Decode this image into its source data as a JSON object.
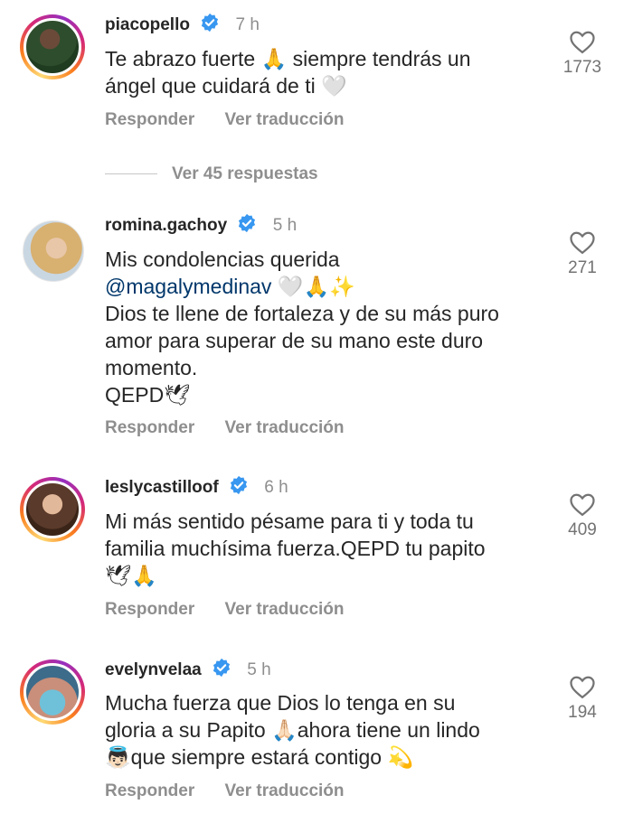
{
  "comments": [
    {
      "username": "piacopello",
      "time": "7 h",
      "text_lines": [
        "Te abrazo fuerte 🙏 siempre tendrás un",
        "ángel que cuidará de ti 🤍"
      ],
      "likes": "1773",
      "reply_label": "Responder",
      "translate_label": "Ver traducción",
      "view_replies": "Ver 45 respuestas",
      "avatar_icon": "profile-photo"
    },
    {
      "username": "romina.gachoy",
      "time": "5 h",
      "line1": "Mis condolencias querida",
      "mention": "@magalymedinav",
      "mention_suffix": " 🤍🙏✨",
      "line3": "Dios te llene de fortaleza y de su más puro",
      "line4": "amor para superar de su mano este duro",
      "line5": "momento.",
      "line6": "QEPD🕊",
      "likes": "271",
      "reply_label": "Responder",
      "translate_label": "Ver traducción",
      "avatar_icon": "profile-photo"
    },
    {
      "username": "leslycastilloof",
      "time": "6 h",
      "text_lines": [
        "Mi más sentido pésame para ti y toda tu",
        "familia muchísima fuerza.QEPD tu papito",
        "🕊🙏"
      ],
      "likes": "409",
      "reply_label": "Responder",
      "translate_label": "Ver traducción",
      "avatar_icon": "profile-photo"
    },
    {
      "username": "evelynvelaa",
      "time": "5 h",
      "text_lines": [
        "Mucha fuerza que Dios lo tenga en su",
        "gloria a su Papito 🙏🏻ahora tiene un lindo",
        "👼🏻que siempre estará contigo 💫"
      ],
      "likes": "194",
      "reply_label": "Responder",
      "translate_label": "Ver traducción",
      "avatar_icon": "profile-photo"
    }
  ],
  "colors": {
    "verified": "#3897f0",
    "secondary_text": "#8e8e8e",
    "mention": "#00376b"
  }
}
